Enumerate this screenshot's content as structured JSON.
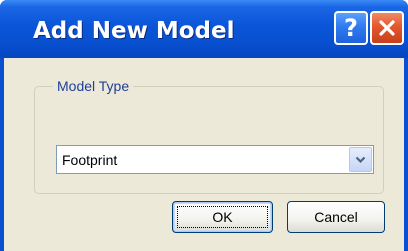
{
  "window": {
    "title": "Add New Model",
    "help_label": "?",
    "close_label": "✕"
  },
  "group": {
    "label": "Model Type"
  },
  "model_type": {
    "selected": "Footprint"
  },
  "buttons": {
    "ok": "OK",
    "cancel": "Cancel"
  },
  "colors": {
    "titlebar": "#0a55d8",
    "dialog_background": "#ece9d8",
    "group_label": "#1f3f9a",
    "close_button": "#e3572e"
  },
  "icons": {
    "help": "question-mark-icon",
    "close": "close-icon",
    "dropdown": "chevron-down-icon"
  }
}
